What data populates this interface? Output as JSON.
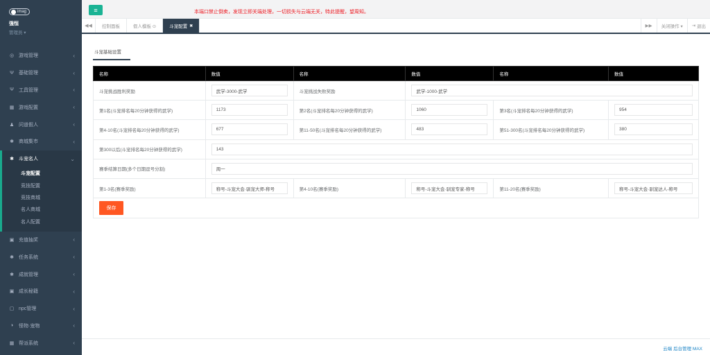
{
  "sidebar": {
    "logo_text": "imag",
    "user_name": "强恒",
    "user_role": "管理员 ▾",
    "items": [
      {
        "icon": "gamepad-icon",
        "glyph": "◎",
        "label": "游戏管理"
      },
      {
        "icon": "fork-icon",
        "glyph": "Ψ",
        "label": "基础管理"
      },
      {
        "icon": "fork-icon",
        "glyph": "Ψ",
        "label": "工具管理"
      },
      {
        "icon": "table-icon",
        "glyph": "▦",
        "label": "游戏配置"
      },
      {
        "icon": "user-icon",
        "glyph": "♟",
        "label": "问道假人"
      },
      {
        "icon": "gear-icon",
        "glyph": "✱",
        "label": "商城集市"
      },
      {
        "icon": "gear-icon",
        "glyph": "✱",
        "label": "斗宠名人"
      },
      {
        "icon": "card-icon",
        "glyph": "▣",
        "label": "充值抽奖"
      },
      {
        "icon": "gear-icon",
        "glyph": "✱",
        "label": "任务系统"
      },
      {
        "icon": "gear-icon",
        "glyph": "✱",
        "label": "成就管理"
      },
      {
        "icon": "card-icon",
        "glyph": "▣",
        "label": "成长秘籍"
      },
      {
        "icon": "square-icon",
        "glyph": "▢",
        "label": "npc管理"
      },
      {
        "icon": "halfcircle-icon",
        "glyph": "◑",
        "label": "怪物·宠物"
      },
      {
        "icon": "table-icon",
        "glyph": "▦",
        "label": "帮派系统"
      }
    ],
    "submenu": [
      "斗宠配置",
      "竞技配置",
      "竞技商城",
      "名人商城",
      "名人配置"
    ]
  },
  "topbar": {
    "notice": "本端口禁止倒卖，发现立即关端处理，一切损失与云端无关，特此提醒，望周知。"
  },
  "tabs": {
    "items": [
      "控制面板",
      "假人模板 ⊙",
      "斗宠配置"
    ],
    "close_all": "关闭操作 ▾",
    "logout": "退出"
  },
  "page": {
    "tab_title": "斗宠基础设置",
    "headers": [
      "名称",
      "数值",
      "名称",
      "数值",
      "名称",
      "数值"
    ],
    "rows": [
      {
        "l1": "斗宠挑战胜利奖励",
        "v1": "武学-3000-武学",
        "l2": "斗宠挑战失败奖励",
        "v2": "武学-1000-武学"
      },
      {
        "l1": "第1名(斗宠排名每20分钟获得的武学)",
        "v1": "1173",
        "l2": "第2名(斗宠排名每20分钟获得的武学)",
        "v2": "1060",
        "l3": "第3名(斗宠排名每20分钟获得的武学)",
        "v3": "954"
      },
      {
        "l1": "第4-10名(斗宠排名每20分钟获得的武学)",
        "v1": "677",
        "l2": "第11-50名(斗宠排名每20分钟获得的武学)",
        "v2": "483",
        "l3": "第51-300名(斗宠排名每20分钟获得的武学)",
        "v3": "380"
      },
      {
        "l1": "第300以后(斗宠排名每20分钟获得的武学)",
        "v1": "143"
      },
      {
        "l1": "赛季结算日期(多个日期逗号分割)",
        "v1": "周一"
      },
      {
        "l1": "第1-3名(赛季奖励)",
        "v1": "称号-斗宠大会·驯宠大师-称号",
        "l2": "第4-10名(赛季奖励)",
        "v2": "称号-斗宠大会·驯宠专家-称号",
        "l3": "第11-20名(赛季奖励)",
        "v3": "称号-斗宠大会·驯宠达人-称号"
      }
    ],
    "save_label": "保存"
  },
  "footer": {
    "text": "云端 后台管理 MAX"
  },
  "colors": {
    "sidebar": "#2f4050",
    "accent": "#1ab394",
    "save": "#ff5722",
    "notice": "#ed1c24"
  }
}
